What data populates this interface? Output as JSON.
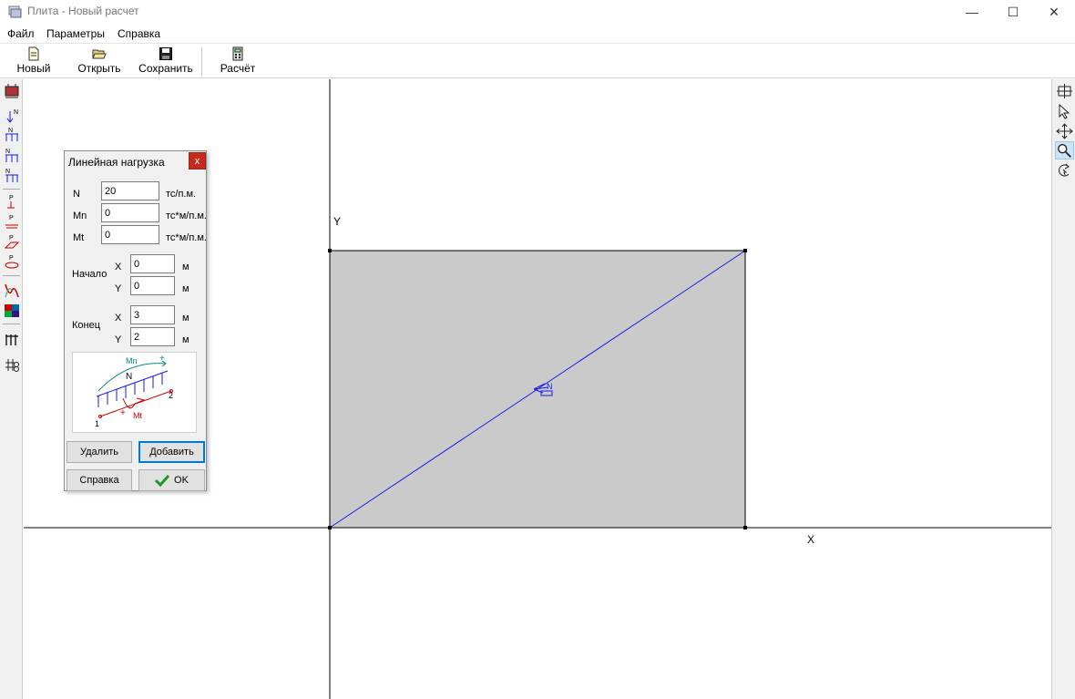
{
  "window": {
    "title": "Плита - Новый расчет",
    "minimize": "—",
    "maximize": "☐",
    "close": "✕"
  },
  "menu": {
    "items": [
      "Файл",
      "Параметры",
      "Справка"
    ]
  },
  "toolbar": {
    "new_label": "Новый",
    "open_label": "Открыть",
    "save_label": "Сохранить",
    "calc_label": "Расчёт"
  },
  "canvas": {
    "x_axis_label": "X",
    "y_axis_label": "Y",
    "load_marker_label": "N",
    "plate_color": "#cacaca",
    "load_line_color": "#1a1aee"
  },
  "dialog": {
    "title": "Линейная нагрузка",
    "close": "x",
    "n_label": "N",
    "n_value": "20",
    "n_unit": "тс/п.м.",
    "mn_label": "Mn",
    "mn_value": "0",
    "mn_unit": "тс*м/п.м.",
    "mt_label": "Mt",
    "mt_value": "0",
    "mt_unit": "тс*м/п.м.",
    "start_label": "Начало",
    "start_x_label": "X",
    "start_x_value": "0",
    "start_x_unit": "м",
    "start_y_label": "Y",
    "start_y_value": "0",
    "start_y_unit": "м",
    "end_label": "Конец",
    "end_x_label": "X",
    "end_x_value": "3",
    "end_x_unit": "м",
    "end_y_label": "Y",
    "end_y_value": "2",
    "end_y_unit": "м",
    "diagram": {
      "mn": "Mn",
      "n": "N",
      "mt": "Mt",
      "plus": "+",
      "p1": "1",
      "p2": "2"
    },
    "delete_button": "Удалить",
    "add_button": "Добавить",
    "help_button": "Справка",
    "ok_button": "OK"
  }
}
